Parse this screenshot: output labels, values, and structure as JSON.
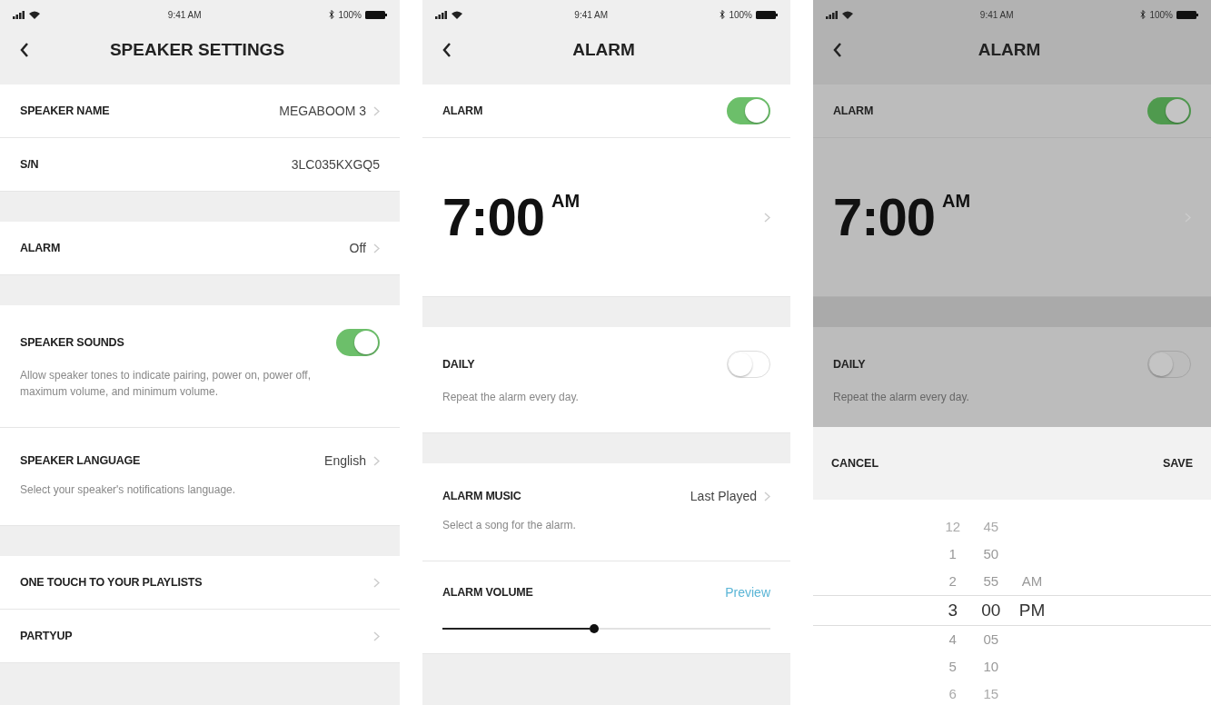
{
  "screens": [
    {
      "status": {
        "time": "9:41 AM",
        "battery": "100%"
      },
      "title": "SPEAKER SETTINGS",
      "dimmed": false,
      "sections": [
        {
          "rows": [
            {
              "kind": "value",
              "label": "SPEAKER NAME",
              "value": "MEGABOOM 3"
            },
            {
              "kind": "text",
              "label": "S/N",
              "value": "3LC035KXGQ5"
            }
          ]
        },
        {
          "rows": [
            {
              "kind": "value",
              "label": "ALARM",
              "value": "Off"
            }
          ]
        },
        {
          "rows": [
            {
              "kind": "toggle",
              "label": "SPEAKER SOUNDS",
              "on": true,
              "description": "Allow speaker tones to indicate pairing, power on, power off, maximum volume, and minimum volume."
            },
            {
              "kind": "value",
              "label": "SPEAKER LANGUAGE",
              "value": "English",
              "description": "Select your speaker's notifications language."
            }
          ]
        },
        {
          "rows": [
            {
              "kind": "link",
              "label": "ONE TOUCH TO YOUR PLAYLISTS"
            },
            {
              "kind": "link",
              "label": "PARTYUP"
            }
          ]
        }
      ]
    },
    {
      "status": {
        "time": "9:41 AM",
        "battery": "100%"
      },
      "title": "ALARM",
      "dimmed": false,
      "sections": [
        {
          "rows": [
            {
              "kind": "toggle",
              "label": "ALARM",
              "on": true
            },
            {
              "kind": "time",
              "time": "7:00",
              "suffix": "AM"
            }
          ]
        },
        {
          "rows": [
            {
              "kind": "toggle",
              "label": "DAILY",
              "on": false,
              "description": "Repeat the alarm every day."
            }
          ]
        },
        {
          "rows": [
            {
              "kind": "value",
              "label": "ALARM MUSIC",
              "value": "Last Played",
              "description": "Select a song for the alarm."
            },
            {
              "kind": "slider",
              "label": "ALARM VOLUME",
              "action": "Preview",
              "level": 0.45
            }
          ]
        }
      ]
    },
    {
      "status": {
        "time": "9:41 AM",
        "battery": "100%"
      },
      "title": "ALARM",
      "dimmed": true,
      "sections": [
        {
          "rows": [
            {
              "kind": "toggle",
              "label": "ALARM",
              "on": true
            },
            {
              "kind": "time",
              "time": "7:00",
              "suffix": "AM"
            }
          ]
        },
        {
          "rows": [
            {
              "kind": "toggle",
              "label": "DAILY",
              "on": false,
              "description": "Repeat the alarm every day."
            }
          ]
        }
      ],
      "sheet": {
        "cancel": "CANCEL",
        "save": "SAVE"
      },
      "picker": [
        {
          "items": [
            {
              "text": "12",
              "selected": false
            },
            {
              "text": "1",
              "selected": false
            },
            {
              "text": "2",
              "selected": false
            },
            {
              "text": "3",
              "selected": true
            },
            {
              "text": "4",
              "selected": false
            },
            {
              "text": "5",
              "selected": false
            },
            {
              "text": "6",
              "selected": false
            }
          ]
        },
        {
          "items": [
            {
              "text": "45",
              "selected": false
            },
            {
              "text": "50",
              "selected": false
            },
            {
              "text": "55",
              "selected": false
            },
            {
              "text": "00",
              "selected": true
            },
            {
              "text": "05",
              "selected": false
            },
            {
              "text": "10",
              "selected": false
            },
            {
              "text": "15",
              "selected": false
            }
          ]
        },
        {
          "items": [
            {
              "text": "AM",
              "selected": false
            },
            {
              "text": "PM",
              "selected": true
            }
          ]
        }
      ]
    }
  ]
}
